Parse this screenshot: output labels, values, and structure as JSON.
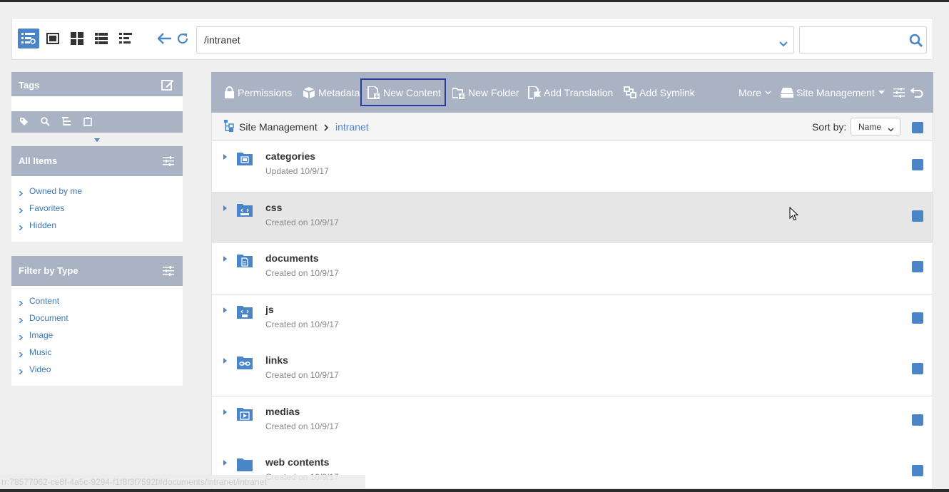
{
  "toolbar": {
    "view_buttons": [
      "view-settings-icon",
      "fullscreen-icon",
      "thumbnails-icon",
      "list-icon",
      "detail-list-icon"
    ],
    "path_value": "/intranet",
    "search_placeholder": ""
  },
  "sidebar": {
    "tags": {
      "title": "Tags"
    },
    "all_items": {
      "title": "All Items",
      "items": [
        "Owned by me",
        "Favorites",
        "Hidden"
      ]
    },
    "filter_by_type": {
      "title": "Filter by Type",
      "items": [
        "Content",
        "Document",
        "Image",
        "Music",
        "Video"
      ]
    }
  },
  "actions": {
    "permissions": "Permissions",
    "metadata": "Metadata",
    "new_content": "New Content",
    "new_folder": "New Folder",
    "add_translation": "Add Translation",
    "add_symlink": "Add Symlink",
    "more": "More",
    "site_management": "Site Management"
  },
  "breadcrumb": {
    "root": "Site Management",
    "current": "intranet"
  },
  "sort": {
    "label": "Sort by:",
    "value": "Name"
  },
  "rows": [
    {
      "name": "categories",
      "meta": "Updated 10/9/17",
      "icon": "categories-folder-icon"
    },
    {
      "name": "css",
      "meta": "Created on 10/9/17",
      "icon": "css-folder-icon"
    },
    {
      "name": "documents",
      "meta": "Created on 10/9/17",
      "icon": "documents-folder-icon"
    },
    {
      "name": "js",
      "meta": "Created on 10/9/17",
      "icon": "js-folder-icon"
    },
    {
      "name": "links",
      "meta": "Created on 10/9/17",
      "icon": "links-folder-icon"
    },
    {
      "name": "medias",
      "meta": "Created on 10/9/17",
      "icon": "medias-folder-icon"
    },
    {
      "name": "web contents",
      "meta": "Created on 10/9/17",
      "icon": "folder-icon"
    }
  ],
  "status": {
    "text": "rr:78577062-ce8f-4a5c-9294-f1f8f3f7592f#documents/intranet/intranet"
  },
  "colors": {
    "accent": "#4a86c7",
    "bar": "#a9b3c4",
    "focus": "#273c9c"
  }
}
